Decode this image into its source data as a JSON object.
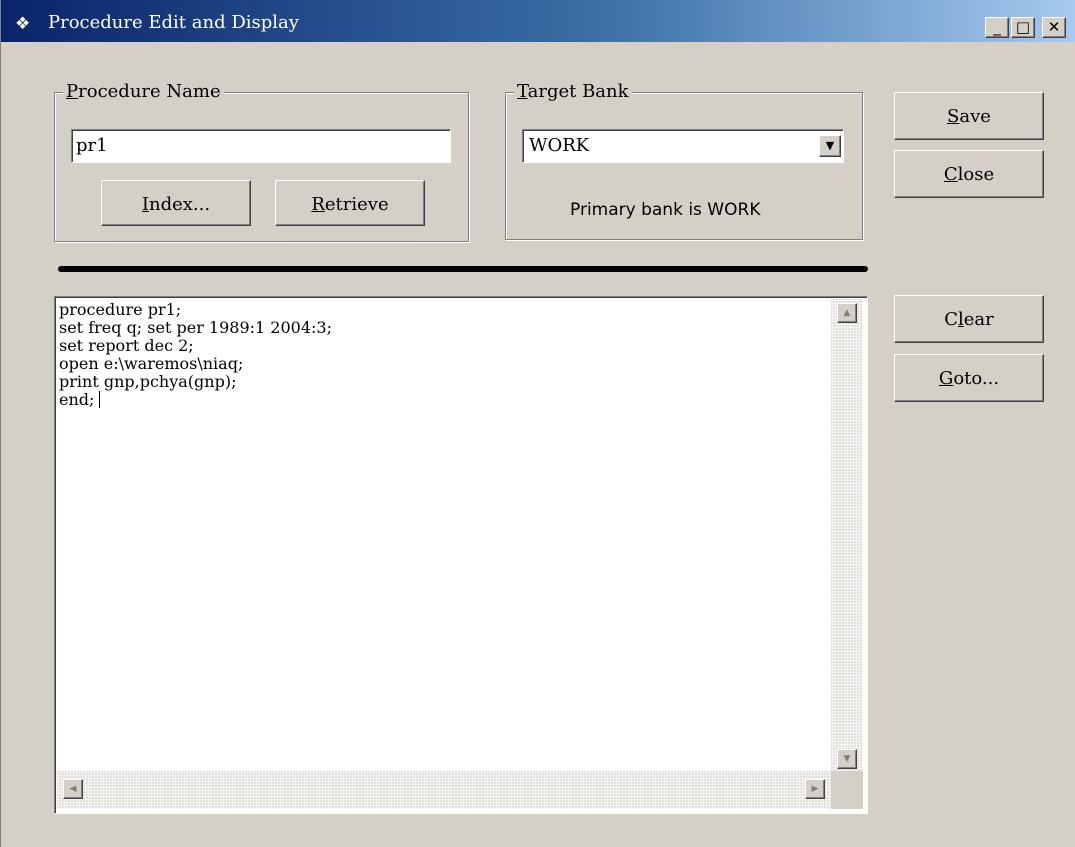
{
  "window": {
    "title": "Procedure Edit and Display",
    "app_icon": "app-icon",
    "controls": {
      "minimize": "_",
      "maximize": "□",
      "close": "✕"
    }
  },
  "procedure_name": {
    "group_label_hotkey": "P",
    "group_label_rest": "rocedure Name",
    "input_value": "pr1",
    "index_button_hotkey": "I",
    "index_button_rest": "ndex...",
    "retrieve_button_hotkey": "R",
    "retrieve_button_rest": "etrieve"
  },
  "target_bank": {
    "group_label_hotkey": "T",
    "group_label_rest": "arget Bank",
    "selected": "WORK",
    "status": "Primary bank is WORK"
  },
  "buttons": {
    "save_hotkey": "S",
    "save_rest": "ave",
    "close_hotkey": "C",
    "close_rest": "lose",
    "clear_pre": "C",
    "clear_hotkey": "l",
    "clear_post": "ear",
    "goto_hotkey": "G",
    "goto_rest": "oto..."
  },
  "editor": {
    "content": "procedure pr1;\nset freq q; set per 1989:1 2004:3;\nset report dec 2;\nopen e:\\waremos\\niaq;\nprint gnp,pchya(gnp);\nend;"
  },
  "scrollbar": {
    "up": "▲",
    "down": "▼",
    "left": "◀",
    "right": "▶"
  }
}
